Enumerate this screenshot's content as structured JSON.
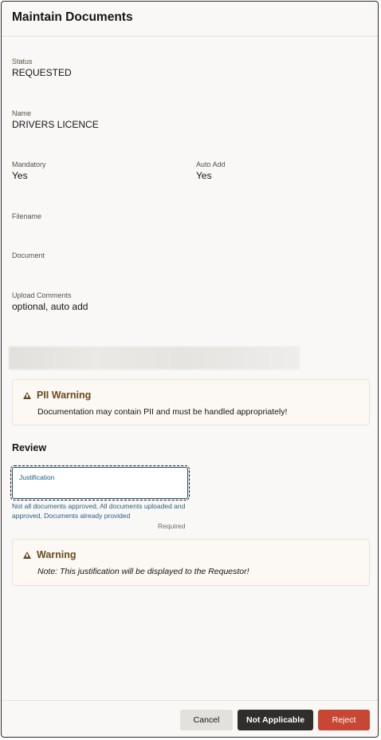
{
  "dialog": {
    "title": "Maintain Documents"
  },
  "fields": {
    "status": {
      "label": "Status",
      "value": "REQUESTED"
    },
    "name": {
      "label": "Name",
      "value": "DRIVERS LICENCE"
    },
    "mandatory": {
      "label": "Mandatory",
      "value": "Yes"
    },
    "auto_add": {
      "label": "Auto Add",
      "value": "Yes"
    },
    "filename": {
      "label": "Filename",
      "value": ""
    },
    "document": {
      "label": "Document",
      "value": ""
    },
    "upload_comments": {
      "label": "Upload Comments",
      "value": "optional, auto add"
    }
  },
  "pii_warning": {
    "icon": "warning-icon",
    "title": "PII Warning",
    "message": "Documentation may contain PII and must be handled appropriately!"
  },
  "review": {
    "title": "Review",
    "justification": {
      "label": "Justification",
      "value": "",
      "help_text": "Not all documents approved, All documents uploaded and approved, Documents already provided",
      "required_text": "Required"
    }
  },
  "warning": {
    "icon": "warning-icon",
    "title": "Warning",
    "message": "Note: This justification will be displayed to the Requestor!"
  },
  "footer": {
    "cancel_label": "Cancel",
    "not_applicable_label": "Not Applicable",
    "reject_label": "Reject"
  },
  "colors": {
    "reject_button": "#c74634",
    "not_applicable_button": "#312d2a",
    "warning_text": "#6a4a1e",
    "focus_border": "#1c4e6e"
  }
}
